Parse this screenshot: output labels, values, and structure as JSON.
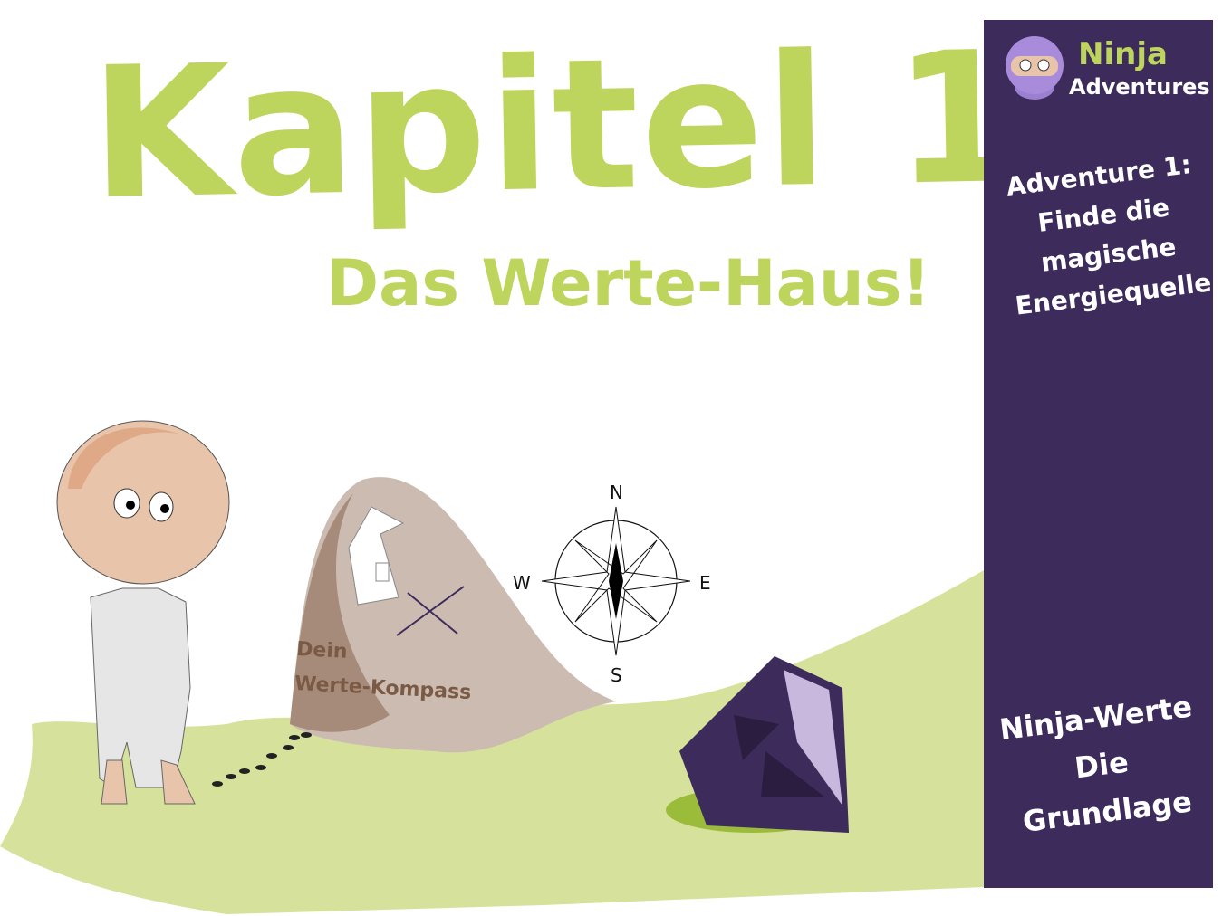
{
  "title": "Kapitel 1",
  "subtitle": "Das Werte-Haus!",
  "sidebar": {
    "logo_line1": "Ninja",
    "logo_line2": "Adventures",
    "adventure_lines": [
      "Adventure 1:",
      "Finde die",
      "magische",
      "Energiequelle"
    ],
    "values_lines": [
      "Ninja-Werte",
      "Die",
      "Grundlage"
    ],
    "background_color": "#3d2b5c"
  },
  "map": {
    "label_line1": "Dein",
    "label_line2": "Werte-Kompass"
  },
  "compass": {
    "n": "N",
    "s": "S",
    "e": "E",
    "w": "W"
  },
  "colors": {
    "accent_green": "#bdd55c",
    "ground": "#d6e29c"
  }
}
